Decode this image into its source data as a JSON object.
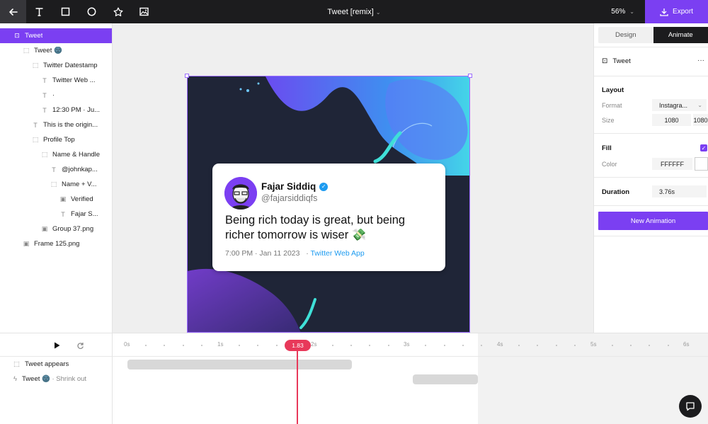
{
  "topbar": {
    "title": "Tweet [remix]",
    "zoom": "56%",
    "export_label": "Export",
    "tools": [
      "back-arrow-icon",
      "text-tool-icon",
      "rectangle-tool-icon",
      "ellipse-tool-icon",
      "star-tool-icon",
      "image-tool-icon"
    ]
  },
  "layers": [
    {
      "label": "Tweet",
      "type": "frame",
      "selected": true
    },
    {
      "label": "Tweet 🌚",
      "type": "group"
    },
    {
      "label": "Twitter Datestamp",
      "type": "group"
    },
    {
      "label": "Twitter Web ...",
      "type": "text"
    },
    {
      "label": "·",
      "type": "text"
    },
    {
      "label": "12:30 PM · Ju...",
      "type": "text"
    },
    {
      "label": "This is the origin...",
      "type": "group"
    },
    {
      "label": "Profile Top",
      "type": "group"
    },
    {
      "label": "Name & Handle",
      "type": "group"
    },
    {
      "label": "@johnkap...",
      "type": "text"
    },
    {
      "label": "Name + V...",
      "type": "group"
    },
    {
      "label": "Verified",
      "type": "image"
    },
    {
      "label": "Fajar S...",
      "type": "text"
    },
    {
      "label": "Group 37.png",
      "type": "image"
    },
    {
      "label": "Frame 125.png",
      "type": "image"
    }
  ],
  "tweet": {
    "name": "Fajar Siddiq",
    "handle": "@fajarsiddiqfs",
    "body": "Being rich today is great, but being richer tomorrow is wiser 💸",
    "time": "7:00 PM · Jan 11 2023",
    "separator": "·",
    "app": "Twitter Web App"
  },
  "right_panel": {
    "tabs": [
      "Design",
      "Animate"
    ],
    "active_tab": "Animate",
    "element": "Tweet",
    "more": "···",
    "layout_heading": "Layout",
    "format_label": "Format",
    "format_value": "Instagra...",
    "size_label": "Size",
    "size_w": "1080",
    "size_h": "1080",
    "fill_heading": "Fill",
    "color_label": "Color",
    "color_value": "FFFFFF",
    "duration_heading": "Duration",
    "duration_value": "3.76s",
    "new_animation_label": "New Animation"
  },
  "timeline": {
    "ticks": [
      "0s",
      "1s",
      "2s",
      "3s",
      "4s",
      "5s",
      "6s"
    ],
    "playhead": "1.83",
    "tracks": [
      {
        "label": "Tweet appears",
        "sub": ""
      },
      {
        "label": "Tweet 🌚",
        "sub": "· Shrink out"
      }
    ]
  },
  "colors": {
    "accent": "#7b3ff2",
    "playhead": "#e8395a",
    "topbar": "#1c1c1e",
    "frame_bg": "#1f2537",
    "link": "#1d9bf0"
  }
}
